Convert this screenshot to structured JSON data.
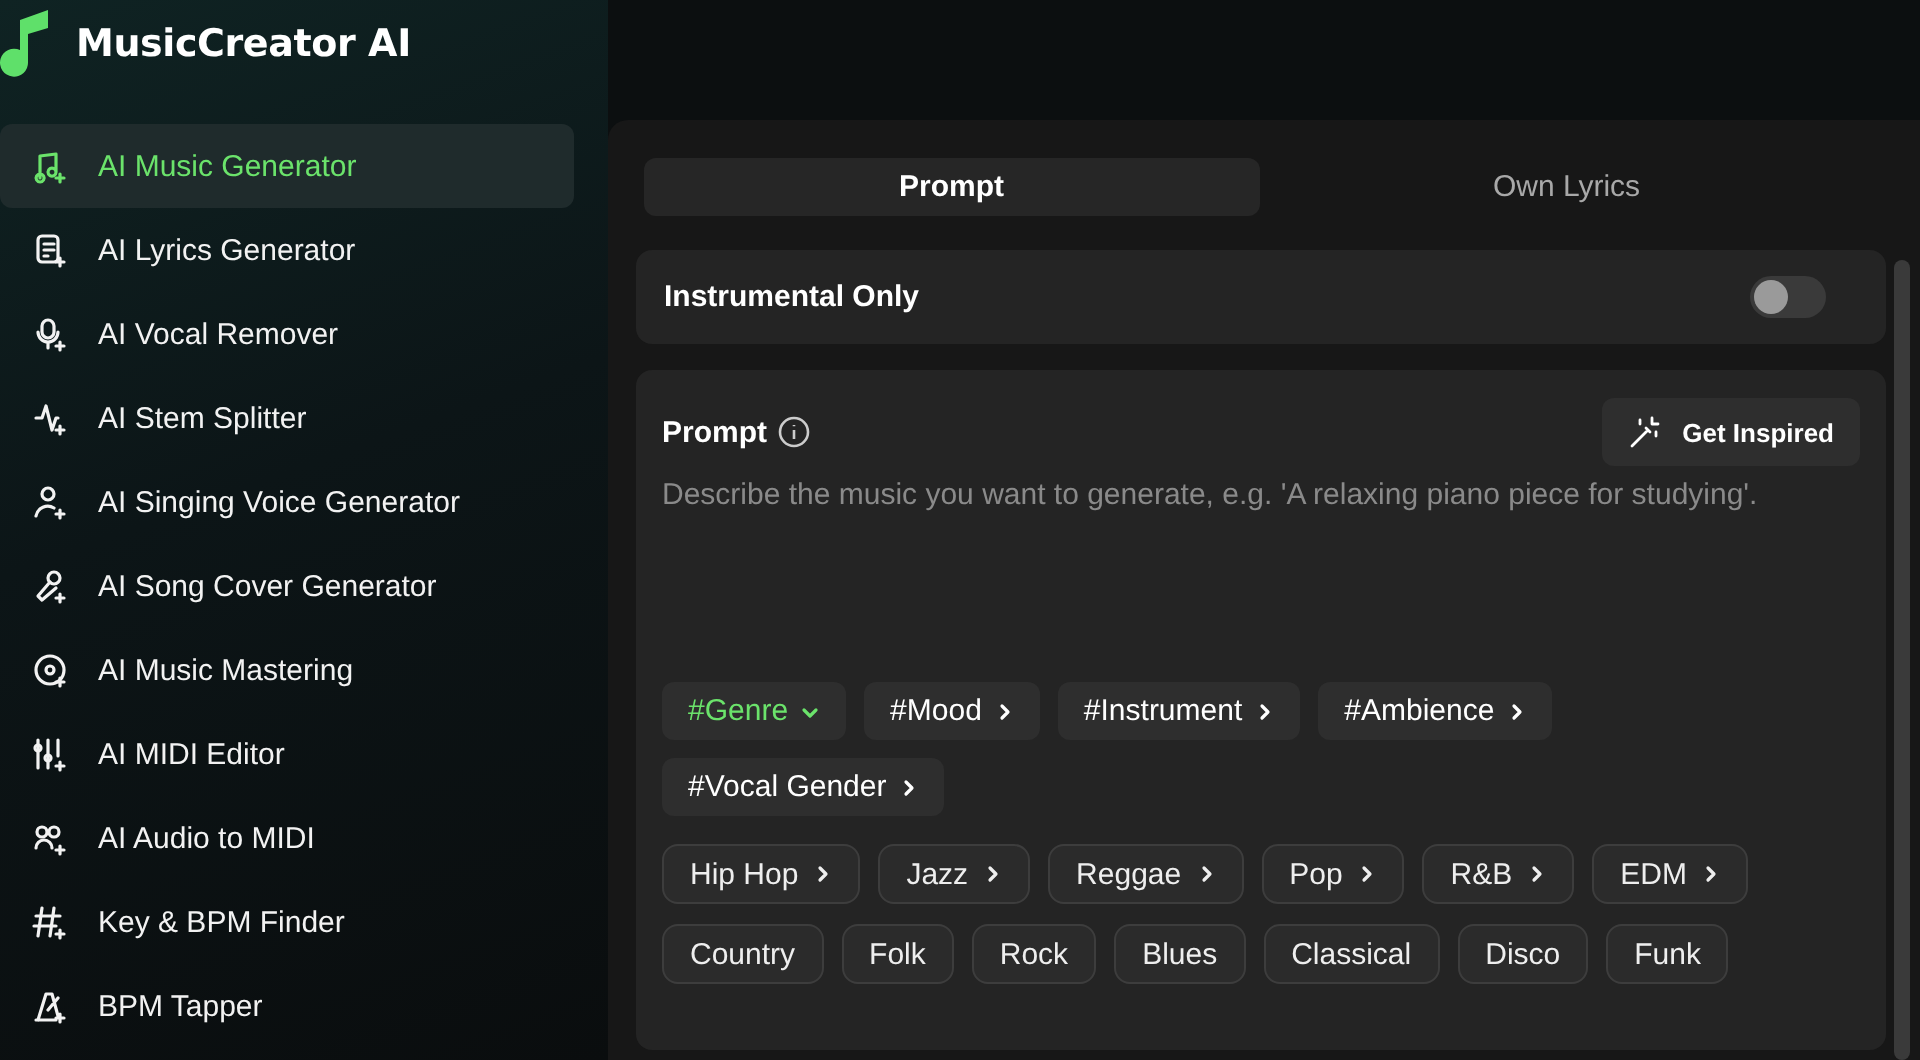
{
  "app": {
    "name": "MusicCreator AI"
  },
  "sidebar": {
    "items": [
      {
        "label": "AI Music Generator",
        "selected": true
      },
      {
        "label": "AI Lyrics Generator",
        "selected": false
      },
      {
        "label": "AI Vocal Remover",
        "selected": false
      },
      {
        "label": "AI Stem Splitter",
        "selected": false
      },
      {
        "label": "AI Singing Voice Generator",
        "selected": false
      },
      {
        "label": "AI Song Cover Generator",
        "selected": false
      },
      {
        "label": "AI Music Mastering",
        "selected": false
      },
      {
        "label": "AI MIDI Editor",
        "selected": false
      },
      {
        "label": "AI Audio to MIDI",
        "selected": false
      },
      {
        "label": "Key & BPM Finder",
        "selected": false
      },
      {
        "label": "BPM Tapper",
        "selected": false
      }
    ]
  },
  "tabs": [
    {
      "label": "Prompt",
      "selected": true
    },
    {
      "label": "Own Lyrics",
      "selected": false
    }
  ],
  "instrumental": {
    "label": "Instrumental Only",
    "on": false
  },
  "prompt": {
    "label": "Prompt",
    "button": "Get Inspired",
    "placeholder": "Describe the music you want to generate, e.g. 'A relaxing piano piece for studying'.",
    "categories": [
      {
        "label": "#Genre",
        "expanded": true
      },
      {
        "label": "#Mood",
        "expanded": false
      },
      {
        "label": "#Instrument",
        "expanded": false
      },
      {
        "label": "#Ambience",
        "expanded": false
      },
      {
        "label": "#Vocal Gender",
        "expanded": false
      }
    ],
    "tags": [
      {
        "label": "Hip Hop",
        "has_more": true
      },
      {
        "label": "Jazz",
        "has_more": true
      },
      {
        "label": "Reggae",
        "has_more": true
      },
      {
        "label": "Pop",
        "has_more": true
      },
      {
        "label": "R&B",
        "has_more": true
      },
      {
        "label": "EDM",
        "has_more": true
      },
      {
        "label": "Country",
        "has_more": false
      },
      {
        "label": "Folk",
        "has_more": false
      },
      {
        "label": "Rock",
        "has_more": false
      },
      {
        "label": "Blues",
        "has_more": false
      },
      {
        "label": "Classical",
        "has_more": false
      },
      {
        "label": "Disco",
        "has_more": false
      },
      {
        "label": "Funk",
        "has_more": false
      }
    ]
  }
}
